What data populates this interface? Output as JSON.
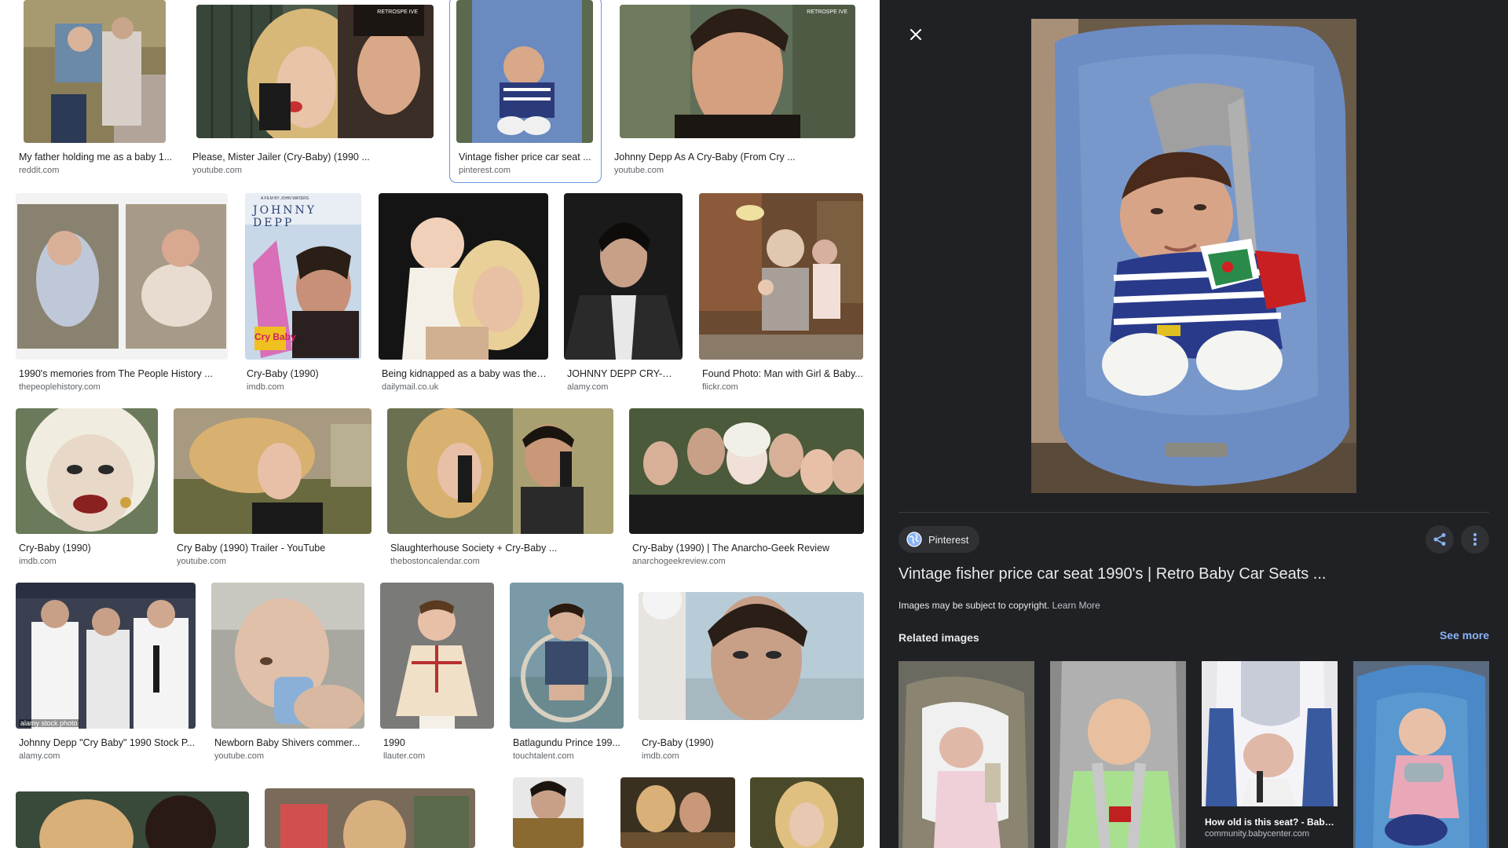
{
  "results": [
    {
      "title": "My father holding me as a baby 1...",
      "source": "reddit.com"
    },
    {
      "title": "Please, Mister Jailer (Cry-Baby) (1990 ...",
      "source": "youtube.com",
      "watermark": "RETROSPE   IVE"
    },
    {
      "title": "Vintage fisher price car seat ...",
      "source": "pinterest.com"
    },
    {
      "title": "Johnny Depp As A Cry-Baby (From Cry ...",
      "source": "youtube.com",
      "watermark": "RETROSPE   IVE"
    },
    {
      "title": "1990's memories from The People History ...",
      "source": "thepeoplehistory.com"
    },
    {
      "title": "Cry-Baby (1990)",
      "source": "imdb.com",
      "poster_top": "A FILM BY JOHN WATERS",
      "poster_name": "JOHNNY DEPP",
      "poster_logo": "Cry Baby"
    },
    {
      "title": "Being kidnapped as a baby was the ...",
      "source": "dailymail.co.uk"
    },
    {
      "title": "JOHNNY DEPP CRY-BA...",
      "source": "alamy.com"
    },
    {
      "title": "Found Photo: Man with Girl & Baby...",
      "source": "flickr.com"
    },
    {
      "title": "Cry-Baby (1990)",
      "source": "imdb.com"
    },
    {
      "title": "Cry Baby (1990) Trailer - YouTube",
      "source": "youtube.com"
    },
    {
      "title": "Slaughterhouse Society + Cry-Baby ...",
      "source": "thebostoncalendar.com"
    },
    {
      "title": "Cry-Baby (1990) | The Anarcho-Geek Review",
      "source": "anarchogeekreview.com"
    },
    {
      "title": "Johnny Depp \"Cry Baby\" 1990 Stock P...",
      "source": "alamy.com",
      "watermark": "alamy stock photo"
    },
    {
      "title": "Newborn Baby Shivers commer...",
      "source": "youtube.com"
    },
    {
      "title": "1990",
      "source": "llauter.com"
    },
    {
      "title": "Batlagundu Prince 199...",
      "source": "touchtalent.com"
    },
    {
      "title": "Cry-Baby (1990)",
      "source": "imdb.com"
    }
  ],
  "viewer": {
    "source_name": "Pinterest",
    "title": "Vintage fisher price car seat 1990's | Retro Baby Car Seats ...",
    "copyright_text": "Images may be subject to copyright.",
    "learn_more": "Learn More",
    "related_heading": "Related images",
    "see_more": "See more",
    "related": [
      {
        "title": "",
        "source": ""
      },
      {
        "title": "",
        "source": ""
      },
      {
        "title": "How old is this seat? - Baby...",
        "source": "community.babycenter.com"
      },
      {
        "title": "",
        "source": ""
      }
    ]
  },
  "colors": {
    "viewer_bg": "#202124",
    "link": "#8ab4f8",
    "selected_outline": "#6a96ea"
  },
  "icons": {
    "close": "close-icon",
    "globe": "globe-icon",
    "share": "share-icon",
    "more": "more-vert-icon"
  }
}
